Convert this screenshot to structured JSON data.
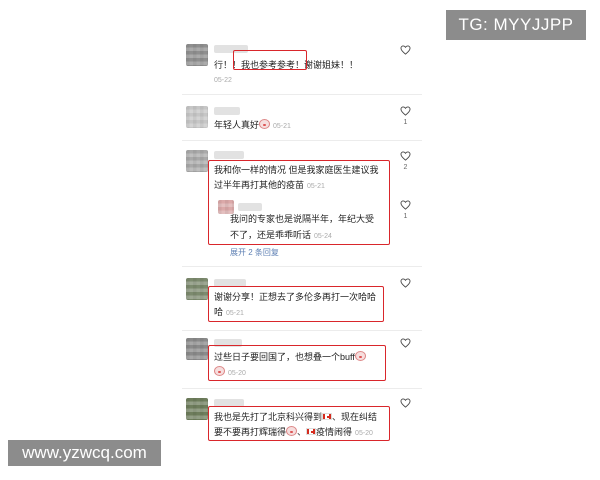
{
  "watermarks": {
    "top_right": "TG: MYYJJPP",
    "bottom_left": "www.yzwcq.com"
  },
  "comments": [
    {
      "text": "行！！我也参考参考！谢谢姐妹！！",
      "date": "05-22",
      "likes": ""
    },
    {
      "text": "年轻人真好",
      "date": "05-21",
      "likes": "1"
    },
    {
      "line1": "我和你一样的情况 但是我家庭医生建议我",
      "line2": "过半年再打其他的疫苗",
      "date": "05-21",
      "likes": "2"
    },
    {
      "line1": "我问的专家也是说隔半年，年纪大受",
      "line2": "不了，还是乖乖听话",
      "date": "05-24",
      "likes": "1",
      "replies_link": "展开 2 条回复"
    },
    {
      "line1": "谢谢分享！正想去了多伦多再打一次哈哈",
      "line2": "哈",
      "date": "05-21",
      "likes": ""
    },
    {
      "line1": "过些日子要回国了，也想叠一个buff",
      "date": "05-20",
      "likes": ""
    },
    {
      "line1a": "我也是先打了北京科兴得到",
      "line1b": "、现在纠结",
      "line2a": "要不要再打辉瑞得",
      "line2b": "、",
      "line2c": "疫情闹得",
      "date": "05-20",
      "likes": ""
    }
  ]
}
